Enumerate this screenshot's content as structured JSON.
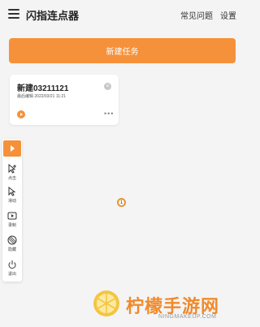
{
  "header": {
    "title": "闪指连点器",
    "faq_label": "常见问题",
    "settings_label": "设置"
  },
  "actions": {
    "new_task_label": "新建任务"
  },
  "task_card": {
    "name": "新建03211121",
    "meta": "最后编辑 2022/03/21 11:21"
  },
  "toolbar": {
    "items": [
      {
        "icon": "add-click-icon",
        "label": "点击"
      },
      {
        "icon": "swipe-icon",
        "label": "滑动"
      },
      {
        "icon": "record-icon",
        "label": "录制"
      },
      {
        "icon": "hide-icon",
        "label": "隐藏"
      },
      {
        "icon": "power-icon",
        "label": "退出"
      }
    ]
  },
  "float_target": {
    "number": "1"
  },
  "watermark": {
    "text": "柠檬手游网",
    "sub": "NINGMAKEUP.COM"
  },
  "colors": {
    "accent": "#f5913a",
    "background": "#f4f4f4",
    "watermark": "#f08a2b"
  }
}
